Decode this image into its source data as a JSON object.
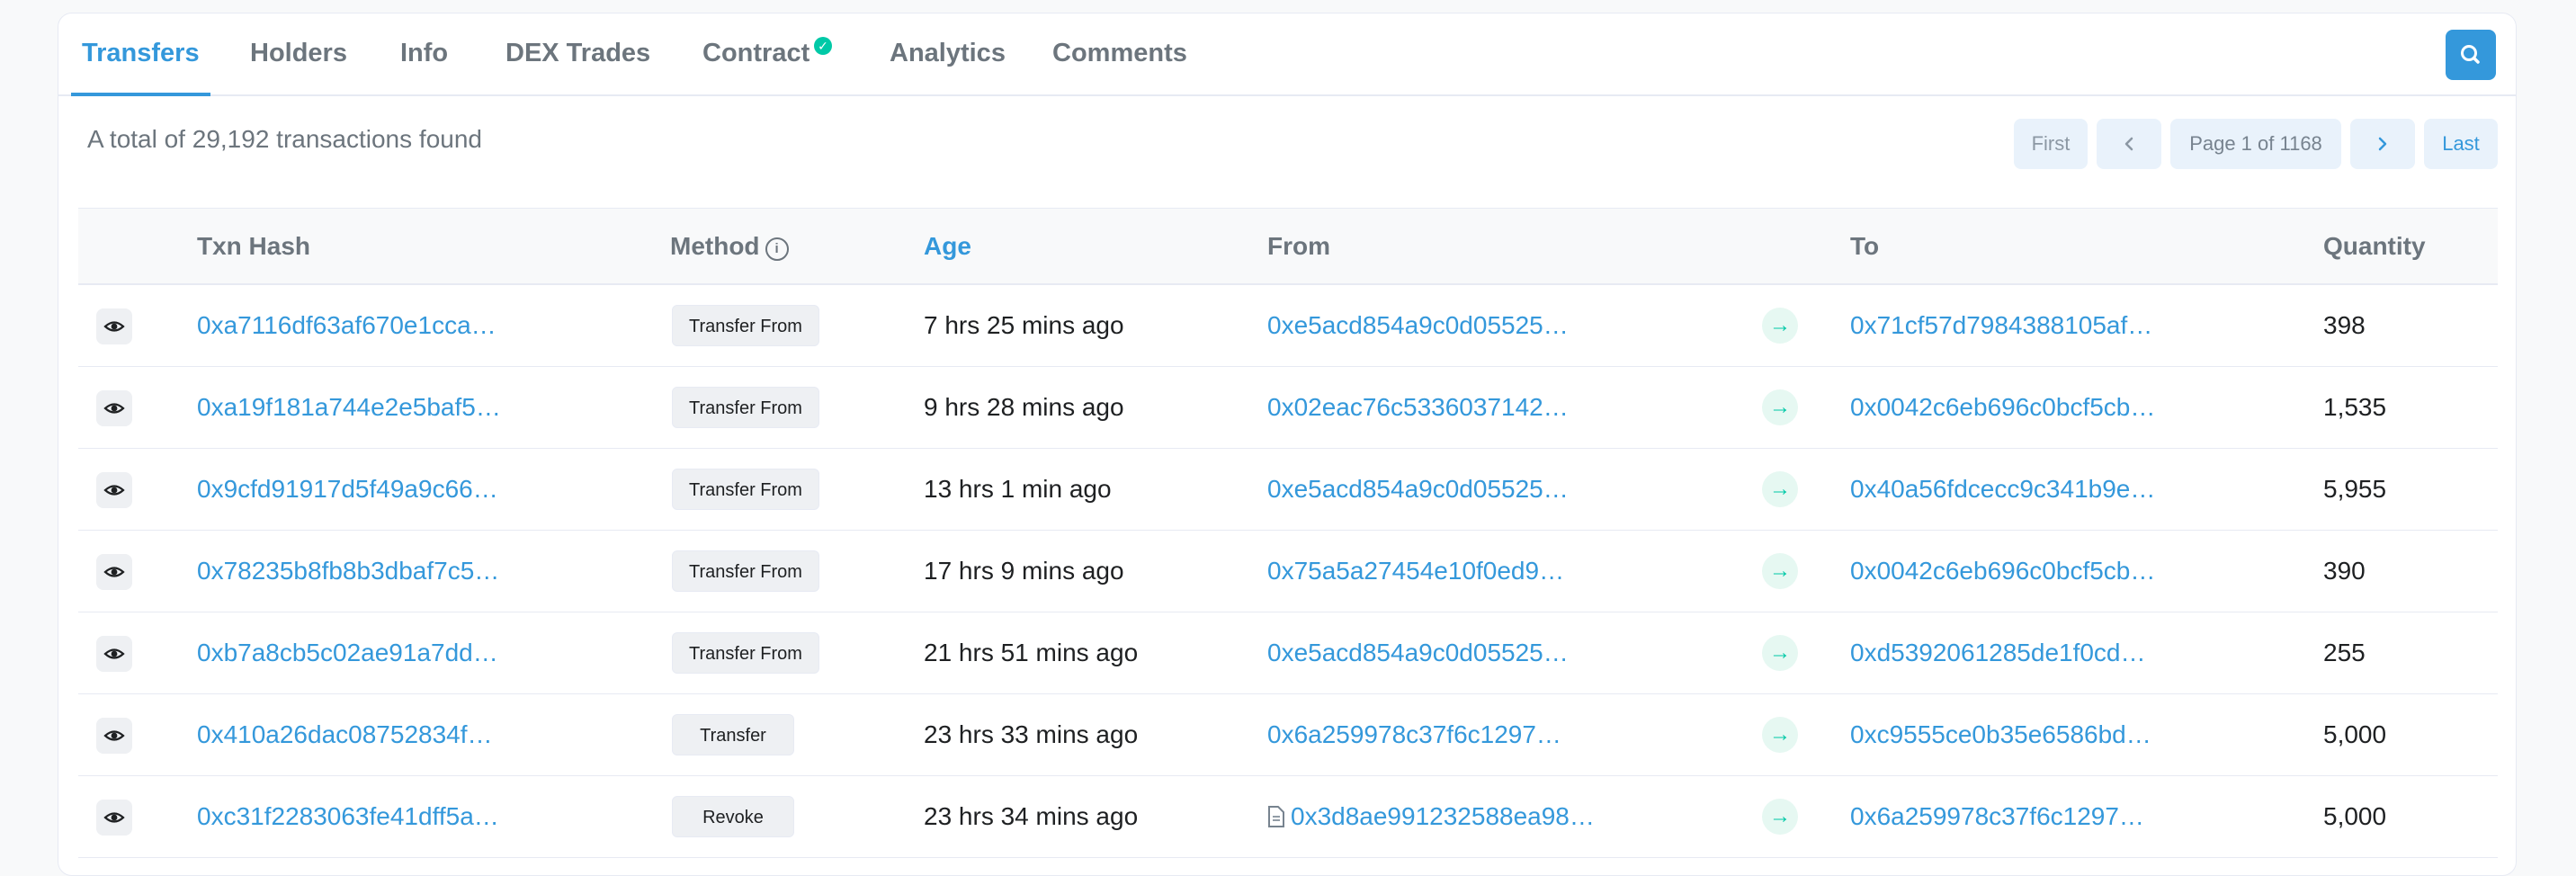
{
  "tabs": [
    {
      "label": "Transfers",
      "active": true
    },
    {
      "label": "Holders"
    },
    {
      "label": "Info"
    },
    {
      "label": "DEX Trades"
    },
    {
      "label": "Contract",
      "verified": true
    },
    {
      "label": "Analytics"
    },
    {
      "label": "Comments"
    }
  ],
  "summary": "A total of 29,192 transactions found",
  "pager": {
    "first": "First",
    "prev_icon": "chevron-left-icon",
    "info": "Page 1 of 1168",
    "next_icon": "chevron-right-icon",
    "last": "Last"
  },
  "table": {
    "headers": {
      "txn_hash": "Txn Hash",
      "method": "Method",
      "age": "Age",
      "from": "From",
      "to": "To",
      "quantity": "Quantity"
    },
    "rows": [
      {
        "hash": "0xa7116df63af670e1cca…",
        "method": "Transfer From",
        "age": "7 hrs 25 mins ago",
        "from": "0xe5acd854a9c0d05525…",
        "to": "0x71cf57d7984388105af…",
        "quantity": "398"
      },
      {
        "hash": "0xa19f181a744e2e5baf5…",
        "method": "Transfer From",
        "age": "9 hrs 28 mins ago",
        "from": "0x02eac76c5336037142…",
        "to": "0x0042c6eb696c0bcf5cb…",
        "quantity": "1,535"
      },
      {
        "hash": "0x9cfd91917d5f49a9c66…",
        "method": "Transfer From",
        "age": "13 hrs 1 min ago",
        "from": "0xe5acd854a9c0d05525…",
        "to": "0x40a56fdcecc9c341b9e…",
        "quantity": "5,955"
      },
      {
        "hash": "0x78235b8fb8b3dbaf7c5…",
        "method": "Transfer From",
        "age": "17 hrs 9 mins ago",
        "from": "0x75a5a27454e10f0ed9…",
        "to": "0x0042c6eb696c0bcf5cb…",
        "quantity": "390"
      },
      {
        "hash": "0xb7a8cb5c02ae91a7dd…",
        "method": "Transfer From",
        "age": "21 hrs 51 mins ago",
        "from": "0xe5acd854a9c0d05525…",
        "to": "0xd5392061285de1f0cd…",
        "quantity": "255"
      },
      {
        "hash": "0x410a26dac08752834f…",
        "method": "Transfer",
        "age": "23 hrs 33 mins ago",
        "from": "0x6a259978c37f6c1297…",
        "to": "0xc9555ce0b35e6586bd…",
        "quantity": "5,000"
      },
      {
        "hash": "0xc31f2283063fe41dff5a…",
        "method": "Revoke",
        "age": "23 hrs 34 mins ago",
        "from": "0x3d8ae991232588ea98…",
        "from_is_contract": true,
        "to": "0x6a259978c37f6c1297…",
        "quantity": "5,000"
      }
    ]
  },
  "colors": {
    "accent": "#3498db",
    "success": "#00c9a7",
    "muted": "#6c757d"
  }
}
